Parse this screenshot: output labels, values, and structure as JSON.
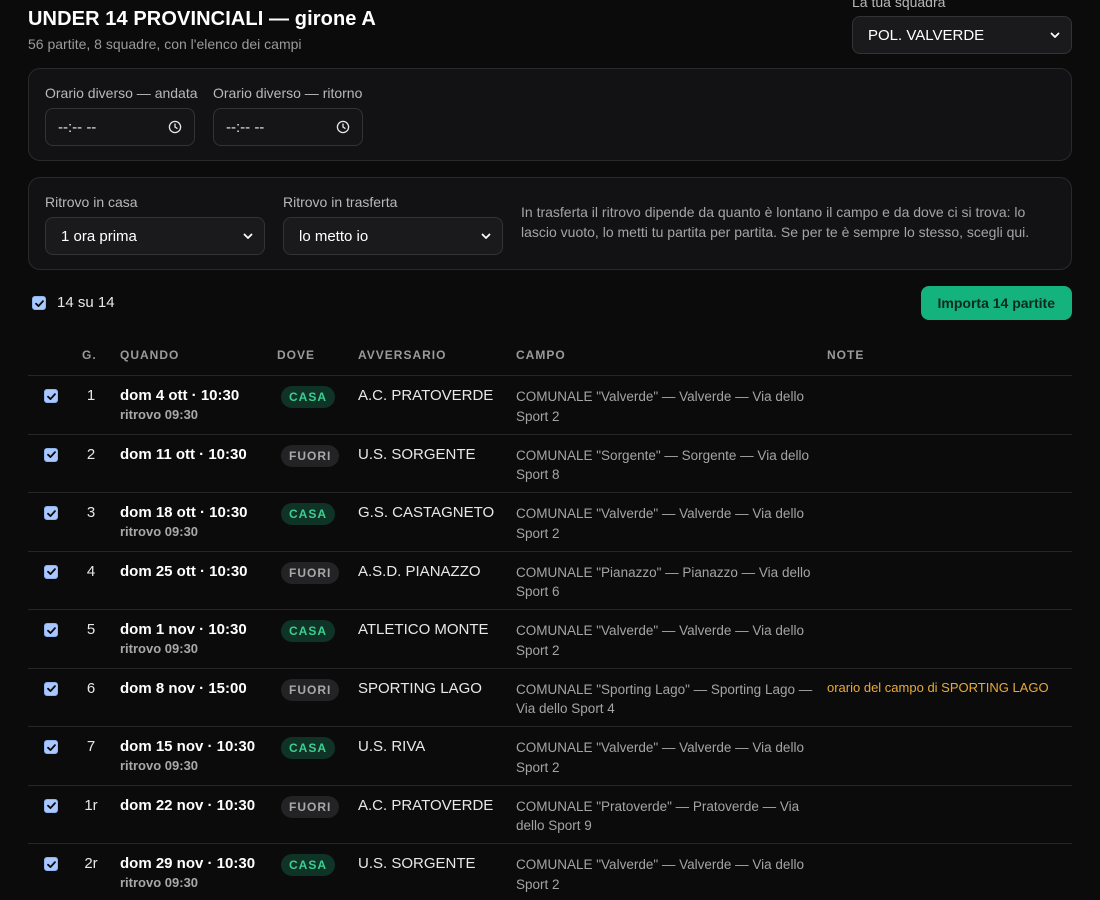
{
  "header": {
    "title": "UNDER 14 PROVINCIALI — girone A",
    "subtitle": "56 partite, 8 squadre, con l'elenco dei campi",
    "team_label": "La tua squadra",
    "team_value": "POL. VALVERDE"
  },
  "times": {
    "andata_label": "Orario diverso — andata",
    "andata_value": "--:-- --",
    "ritorno_label": "Orario diverso — ritorno",
    "ritorno_value": "--:-- --"
  },
  "meeting": {
    "home_label": "Ritrovo in casa",
    "home_value": "1 ora prima",
    "away_label": "Ritrovo in trasferta",
    "away_value": "lo metto io",
    "note": "In trasferta il ritrovo dipende da quanto è lontano il campo e da dove ci si trova: lo lascio vuoto, lo metti tu partita per partita. Se per te è sempre lo stesso, scegli qui."
  },
  "toolbar": {
    "count_label": "14 su 14",
    "import_label": "Importa 14 partite"
  },
  "table": {
    "columns": {
      "g": "G.",
      "quando": "QUANDO",
      "dove": "DOVE",
      "avversario": "AVVERSARIO",
      "campo": "CAMPO",
      "note": "NOTE"
    },
    "rows": [
      {
        "checked": true,
        "g": "1",
        "when": "dom 4 ott · 10:30",
        "ritrovo": "ritrovo 09:30",
        "where": "CASA",
        "opponent": "A.C. PRATOVERDE",
        "field": "COMUNALE \"Valverde\" — Valverde — Via dello Sport 2",
        "note": ""
      },
      {
        "checked": true,
        "g": "2",
        "when": "dom 11 ott · 10:30",
        "ritrovo": "",
        "where": "FUORI",
        "opponent": "U.S. SORGENTE",
        "field": "COMUNALE \"Sorgente\" — Sorgente — Via dello Sport 8",
        "note": ""
      },
      {
        "checked": true,
        "g": "3",
        "when": "dom 18 ott · 10:30",
        "ritrovo": "ritrovo 09:30",
        "where": "CASA",
        "opponent": "G.S. CASTAGNETO",
        "field": "COMUNALE \"Valverde\" — Valverde — Via dello Sport 2",
        "note": ""
      },
      {
        "checked": true,
        "g": "4",
        "when": "dom 25 ott · 10:30",
        "ritrovo": "",
        "where": "FUORI",
        "opponent": "A.S.D. PIANAZZO",
        "field": "COMUNALE \"Pianazzo\" — Pianazzo — Via dello Sport 6",
        "note": ""
      },
      {
        "checked": true,
        "g": "5",
        "when": "dom 1 nov · 10:30",
        "ritrovo": "ritrovo 09:30",
        "where": "CASA",
        "opponent": "ATLETICO MONTE",
        "field": "COMUNALE \"Valverde\" — Valverde — Via dello Sport 2",
        "note": ""
      },
      {
        "checked": true,
        "g": "6",
        "when": "dom 8 nov · 15:00",
        "ritrovo": "",
        "where": "FUORI",
        "opponent": "SPORTING LAGO",
        "field": "COMUNALE \"Sporting Lago\" — Sporting Lago — Via dello Sport 4",
        "note": "orario del campo di SPORTING LAGO"
      },
      {
        "checked": true,
        "g": "7",
        "when": "dom 15 nov · 10:30",
        "ritrovo": "ritrovo 09:30",
        "where": "CASA",
        "opponent": "U.S. RIVA",
        "field": "COMUNALE \"Valverde\" — Valverde — Via dello Sport 2",
        "note": ""
      },
      {
        "checked": true,
        "g": "1r",
        "when": "dom 22 nov · 10:30",
        "ritrovo": "",
        "where": "FUORI",
        "opponent": "A.C. PRATOVERDE",
        "field": "COMUNALE \"Pratoverde\" — Pratoverde — Via dello Sport 9",
        "note": ""
      },
      {
        "checked": true,
        "g": "2r",
        "when": "dom 29 nov · 10:30",
        "ritrovo": "ritrovo 09:30",
        "where": "CASA",
        "opponent": "U.S. SORGENTE",
        "field": "COMUNALE \"Valverde\" — Valverde — Via dello Sport 2",
        "note": ""
      }
    ]
  },
  "colors": {
    "accent": "#14b37d",
    "casa": "#3ccf91",
    "note": "#e8a93a",
    "background": "#0b0b0c"
  }
}
